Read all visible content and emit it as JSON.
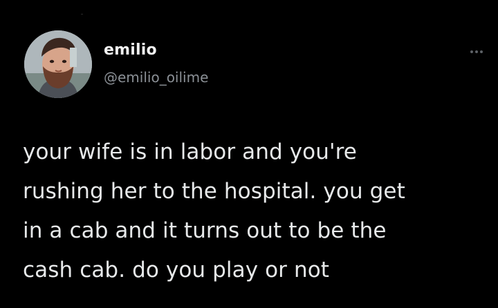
{
  "tweet": {
    "author_name": "emilio",
    "author_handle": "@emilio_oilime",
    "text": "your wife is in labor and you're\nrushing her to the hospital. you get\nin a cab and it turns out to be the\ncash cab. do you play or not",
    "more_icon": "more-horizontal-icon"
  },
  "colors": {
    "background": "#000000",
    "text": "#e7e9ea",
    "secondary_text": "#8b9096"
  }
}
